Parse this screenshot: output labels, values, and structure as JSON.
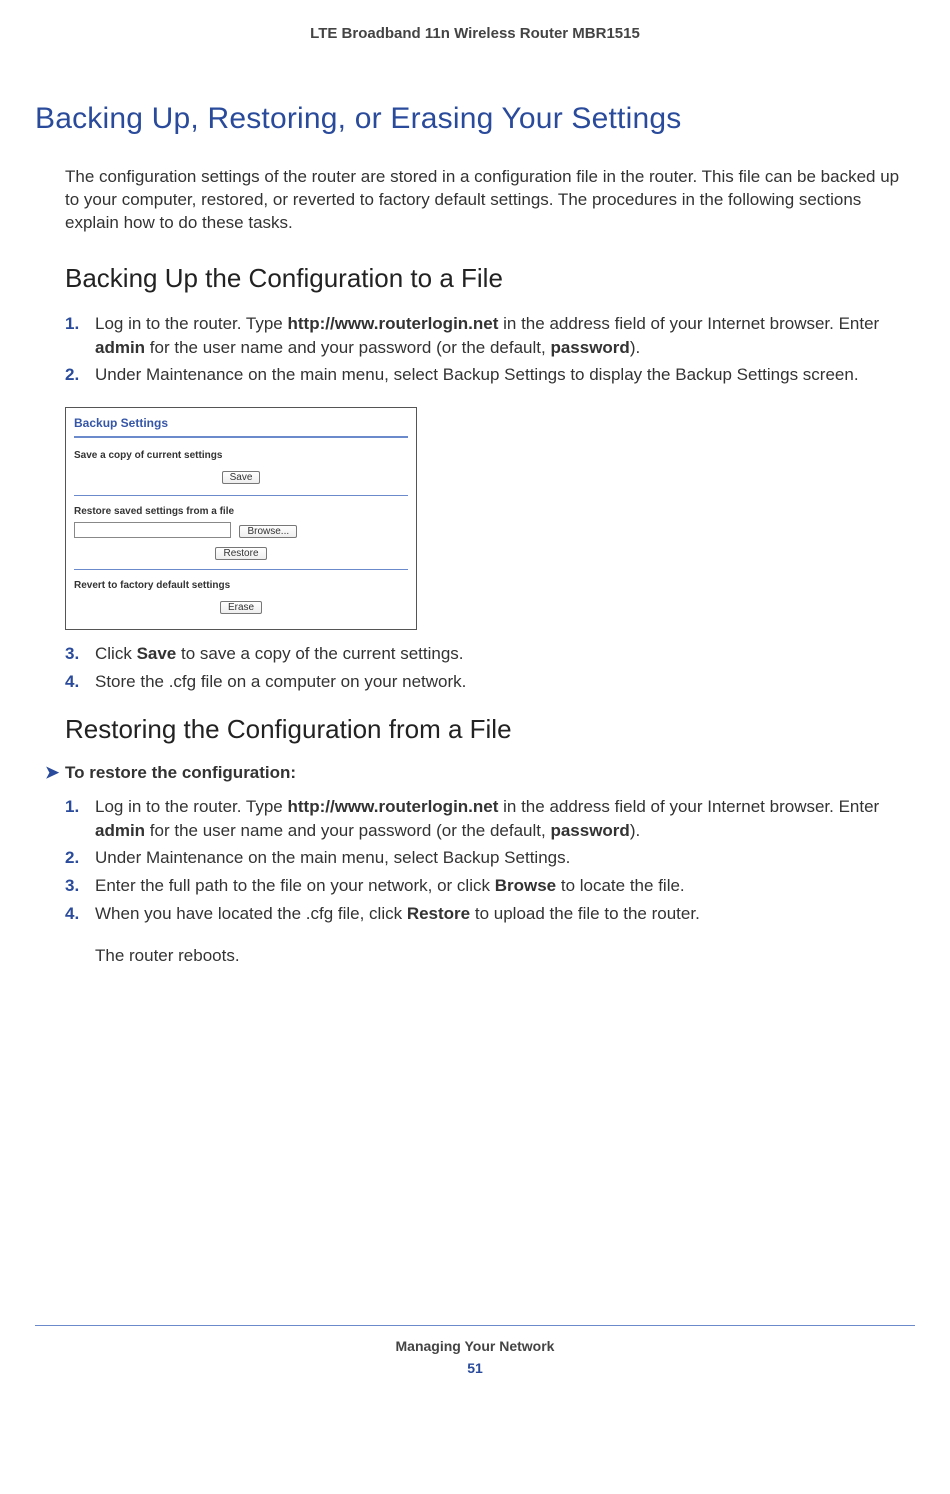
{
  "header": "LTE Broadband 11n Wireless Router MBR1515",
  "title": "Backing Up, Restoring, or Erasing Your Settings",
  "intro": "The configuration settings of the router are stored in a configuration file in the router. This file can be backed up to your computer, restored, or reverted to factory default settings. The procedures in the following sections explain how to do these tasks.",
  "section1": {
    "title": "Backing Up the Configuration to a File",
    "steps": {
      "s1a": "Log in to the router. Type ",
      "s1b": "http://www.routerlogin.net",
      "s1c": " in the address field of your Internet browser. Enter ",
      "s1d": "admin",
      "s1e": " for the user name and your password (or the default, ",
      "s1f": "password",
      "s1g": ").",
      "s2": "Under Maintenance on the main menu, select Backup Settings to display the Backup Settings screen.",
      "s3a": "Click ",
      "s3b": "Save",
      "s3c": " to save a copy of the current settings.",
      "s4": "Store the .cfg file on a computer on your network."
    }
  },
  "shot": {
    "title": "Backup Settings",
    "sec1": "Save a copy of current settings",
    "btn_save": "Save",
    "sec2": "Restore saved settings from a file",
    "btn_browse": "Browse...",
    "btn_restore": "Restore",
    "sec3": "Revert to factory default settings",
    "btn_erase": "Erase"
  },
  "section2": {
    "title": "Restoring the Configuration from a File",
    "proc": "To restore the configuration:",
    "steps": {
      "s1a": "Log in to the router. Type ",
      "s1b": "http://www.routerlogin.net",
      "s1c": " in the address field of your Internet browser. Enter ",
      "s1d": "admin",
      "s1e": " for the user name and your password (or the default, ",
      "s1f": "password",
      "s1g": ").",
      "s2": "Under Maintenance on the main menu, select Backup Settings.",
      "s3a": "Enter the full path to the file on your network, or click ",
      "s3b": "Browse",
      "s3c": " to locate the file.",
      "s4a": "When you have located the .cfg file, click ",
      "s4b": "Restore",
      "s4c": " to upload the file to the router."
    },
    "after": "The router reboots."
  },
  "footer": {
    "chapter": "Managing Your Network",
    "page": "51"
  }
}
